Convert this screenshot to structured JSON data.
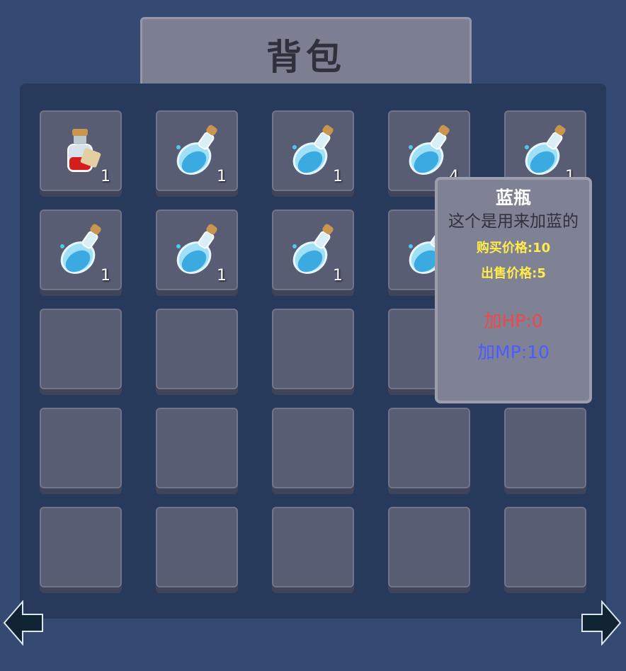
{
  "header": {
    "title": "背包"
  },
  "slots": [
    {
      "item": "red-potion",
      "qty": "1"
    },
    {
      "item": "blue-potion",
      "qty": "1"
    },
    {
      "item": "blue-potion",
      "qty": "1"
    },
    {
      "item": "blue-potion",
      "qty": "4"
    },
    {
      "item": "blue-potion",
      "qty": "1"
    },
    {
      "item": "blue-potion",
      "qty": "1"
    },
    {
      "item": "blue-potion",
      "qty": "1"
    },
    {
      "item": "blue-potion",
      "qty": "1"
    },
    {
      "item": "blue-potion",
      "qty": ""
    },
    {
      "item": "",
      "qty": ""
    },
    {
      "item": "",
      "qty": ""
    },
    {
      "item": "",
      "qty": ""
    },
    {
      "item": "",
      "qty": ""
    },
    {
      "item": "",
      "qty": ""
    },
    {
      "item": "",
      "qty": ""
    },
    {
      "item": "",
      "qty": ""
    },
    {
      "item": "",
      "qty": ""
    },
    {
      "item": "",
      "qty": ""
    },
    {
      "item": "",
      "qty": ""
    },
    {
      "item": "",
      "qty": ""
    },
    {
      "item": "",
      "qty": ""
    },
    {
      "item": "",
      "qty": ""
    },
    {
      "item": "",
      "qty": ""
    },
    {
      "item": "",
      "qty": ""
    },
    {
      "item": "",
      "qty": ""
    }
  ],
  "tooltip": {
    "name": "蓝瓶",
    "description": "这个是用来加蓝的",
    "buy_price": "购买价格:10",
    "sell_price": "出售价格:5",
    "hp": "加HP:0",
    "mp": "加MP:10"
  },
  "nav": {
    "prev_icon": "arrow-left-icon",
    "next_icon": "arrow-right-icon"
  },
  "colors": {
    "background": "#344a72",
    "panel": "#273a5c",
    "slot": "#585d74",
    "price_text": "#ffeb4a",
    "hp_text": "#f04848",
    "mp_text": "#4a5cff"
  }
}
